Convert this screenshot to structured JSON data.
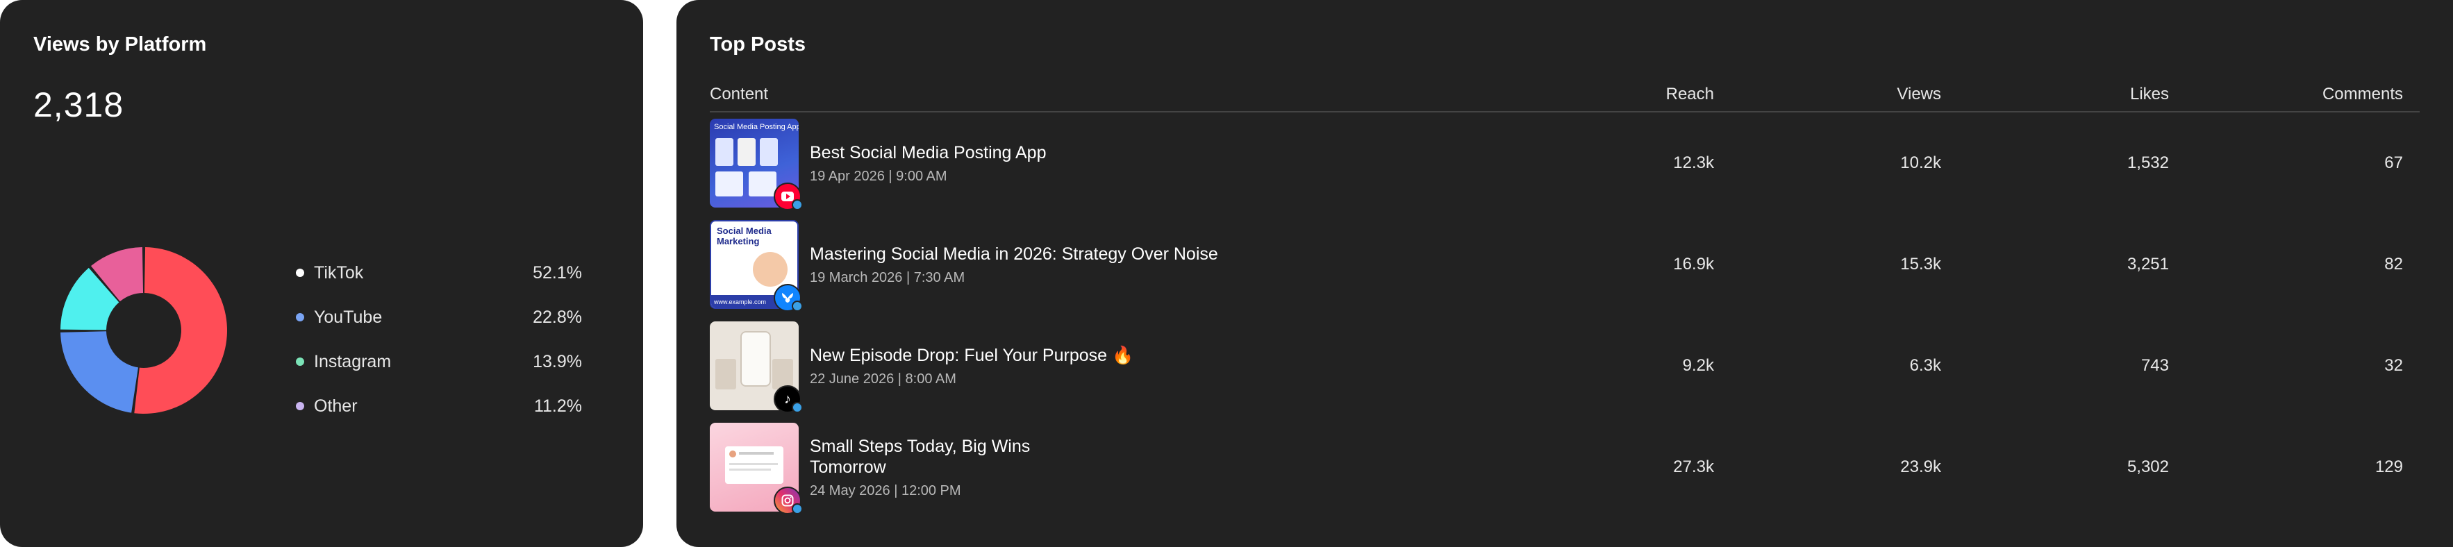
{
  "views_card": {
    "title": "Views by Platform",
    "total": "2,318",
    "legend": [
      {
        "label": "TikTok",
        "value": "52.1%",
        "color": "#ff4d57",
        "dot": "#ffffff"
      },
      {
        "label": "YouTube",
        "value": "22.8%",
        "color": "#5b8ff0",
        "dot": "#7aa4f4"
      },
      {
        "label": "Instagram",
        "value": "13.9%",
        "color": "#4ff0ee",
        "dot": "#7be3b7"
      },
      {
        "label": "Other",
        "value": "11.2%",
        "color": "#e8609a",
        "dot": "#c9b4f0"
      }
    ]
  },
  "chart_data": {
    "type": "pie",
    "categories": [
      "TikTok",
      "YouTube",
      "Instagram",
      "Other"
    ],
    "values": [
      52.1,
      22.8,
      13.9,
      11.2
    ],
    "title": "Views by Platform"
  },
  "posts_card": {
    "title": "Top Posts",
    "columns": {
      "content": "Content",
      "reach": "Reach",
      "views": "Views",
      "likes": "Likes",
      "comments": "Comments"
    },
    "rows": [
      {
        "title": "Best Social Media Posting App",
        "date": "19 Apr 2026 | 9:00 AM",
        "reach": "12.3k",
        "views": "10.2k",
        "likes": "1,532",
        "comments": "67",
        "thumb_text": "Social Media Posting App",
        "platform_icon": "youtube-icon"
      },
      {
        "title": "Mastering Social Media in 2026: Strategy Over Noise",
        "date": "19 March 2026 | 7:30 AM",
        "reach": "16.9k",
        "views": "15.3k",
        "likes": "3,251",
        "comments": "82",
        "thumb_text": "Social Media Marketing",
        "thumb_footer": "www.example.com",
        "platform_icon": "bluesky-icon"
      },
      {
        "title": "New Episode Drop: Fuel Your Purpose 🔥",
        "date": "22 June 2026 | 8:00 AM",
        "reach": "9.2k",
        "views": "6.3k",
        "likes": "743",
        "comments": "32",
        "platform_icon": "tiktok-icon"
      },
      {
        "title": "Small Steps Today, Big Wins Tomorrow",
        "date": "24 May 2026 | 12:00 PM",
        "reach": "27.3k",
        "views": "23.9k",
        "likes": "5,302",
        "comments": "129",
        "platform_icon": "instagram-icon"
      }
    ]
  }
}
